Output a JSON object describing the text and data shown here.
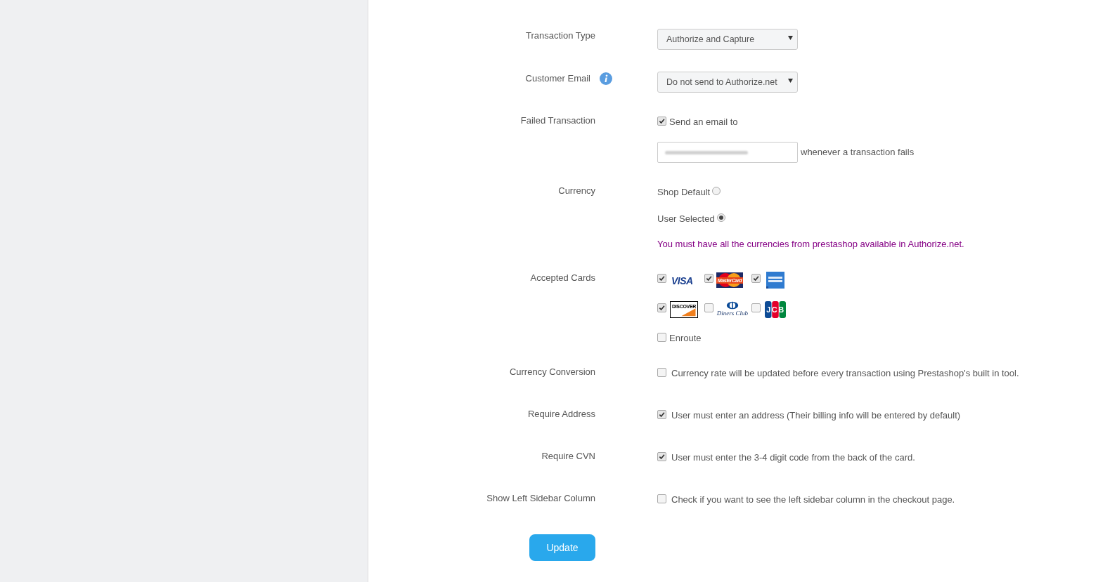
{
  "fields": [
    {
      "kind": "select",
      "label": "Transaction Type",
      "value": "Authorize and Capture"
    },
    {
      "kind": "select",
      "label": "Customer Email",
      "value": "Do not send to Authorize.net",
      "info": true
    },
    {
      "kind": "notify",
      "label": "Failed Transaction",
      "option": "Send an email to",
      "checked": true,
      "suffix": "whenever a transaction fails"
    },
    {
      "kind": "radio",
      "label": "Currency",
      "options": [
        {
          "label": "Shop Default",
          "selected": false
        },
        {
          "label": "User Selected",
          "selected": true
        }
      ],
      "note": "You must have all the currencies from prestashop available in Authorize.net."
    },
    {
      "kind": "cards",
      "label": "Accepted Cards",
      "cards": [
        {
          "kind": "visa",
          "logo_text": "VISA",
          "checked": true
        },
        {
          "kind": "mastercard",
          "logo_text": "MasterCard",
          "checked": true
        },
        {
          "kind": "amex",
          "checked": true
        },
        {
          "kind": "discover",
          "logo_text": "DISCOVER",
          "checked": true
        },
        {
          "kind": "diners",
          "logo_text": "Diners Club",
          "checked": false
        },
        {
          "kind": "jcb",
          "logo_text": "JCB",
          "checked": false
        }
      ],
      "other_cards": [
        {
          "label": "Enroute",
          "checked": false
        }
      ]
    },
    {
      "kind": "checkbox",
      "label": "Currency Conversion",
      "text": "Currency rate will be updated before every transaction using Prestashop's built in tool.",
      "checked": false
    },
    {
      "kind": "checkbox",
      "label": "Require Address",
      "text": "User must enter an address (Their billing info will be entered by default)",
      "checked": true
    },
    {
      "kind": "checkbox",
      "label": "Require CVN",
      "text": "User must enter the 3-4 digit code from the back of the card.",
      "checked": true
    },
    {
      "kind": "checkbox",
      "label": "Show Left Sidebar Column",
      "text": "Check if you want to see the left sidebar column in the checkout page.",
      "checked": false
    }
  ],
  "update_button": "Update"
}
